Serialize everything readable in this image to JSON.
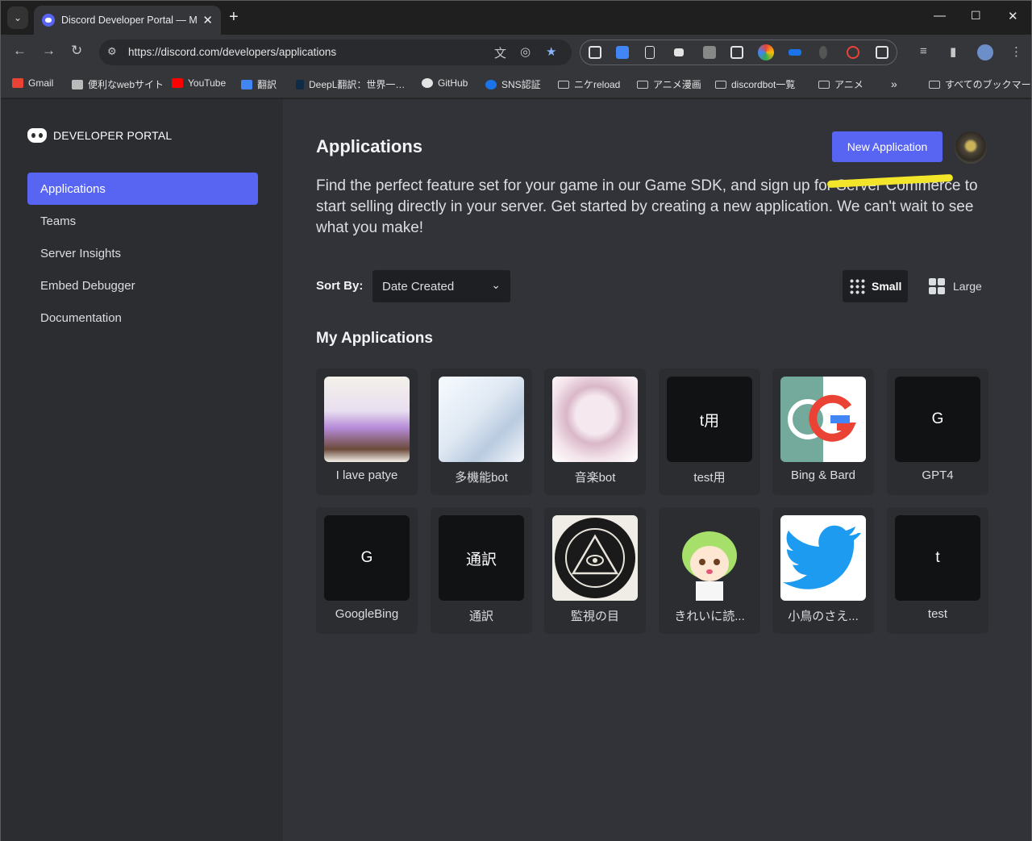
{
  "browser": {
    "tab_title": "Discord Developer Portal — My Applications",
    "url": "https://discord.com/developers/applications",
    "bookmarks": [
      "Gmail",
      "便利なwebサイト",
      "YouTube",
      "翻訳",
      "DeepL翻訳：世界一…",
      "GitHub",
      "SNS認証",
      "ニケreload",
      "アニメ漫画",
      "discordbot一覧",
      "アニメ",
      "すべてのブックマーク"
    ]
  },
  "sidebar": {
    "brand": "DEVELOPER PORTAL",
    "items": [
      {
        "label": "Applications",
        "active": true
      },
      {
        "label": "Teams",
        "active": false
      },
      {
        "label": "Server Insights",
        "active": false
      },
      {
        "label": "Embed Debugger",
        "active": false
      },
      {
        "label": "Documentation",
        "active": false
      }
    ]
  },
  "main": {
    "title": "Applications",
    "new_button": "New Application",
    "description": "Find the perfect feature set for your game in our Game SDK, and sign up for Server Commerce to start selling directly in your server. Get started by creating a new application. We can't wait to see what you make!",
    "sort_label": "Sort By:",
    "sort_value": "Date Created",
    "view_small": "Small",
    "view_large": "Large",
    "section_title": "My Applications",
    "apps": [
      {
        "name": "I lave patye",
        "tile_text": ""
      },
      {
        "name": "多機能bot",
        "tile_text": ""
      },
      {
        "name": "音楽bot",
        "tile_text": ""
      },
      {
        "name": "test用",
        "tile_text": "t用"
      },
      {
        "name": "Bing & Bard",
        "tile_text": ""
      },
      {
        "name": "GPT4",
        "tile_text": "G"
      },
      {
        "name": "GoogleBing",
        "tile_text": "G"
      },
      {
        "name": "通訳",
        "tile_text": "通訳"
      },
      {
        "name": "監視の目",
        "tile_text": ""
      },
      {
        "name": "きれいに読...",
        "tile_text": ""
      },
      {
        "name": "小鳥のさえ...",
        "tile_text": ""
      },
      {
        "name": "test",
        "tile_text": "t"
      }
    ]
  },
  "colors": {
    "accent": "#5865f2",
    "sidebar_bg": "#2b2d31",
    "page_bg": "#313338",
    "highlight": "#f2e52a"
  }
}
